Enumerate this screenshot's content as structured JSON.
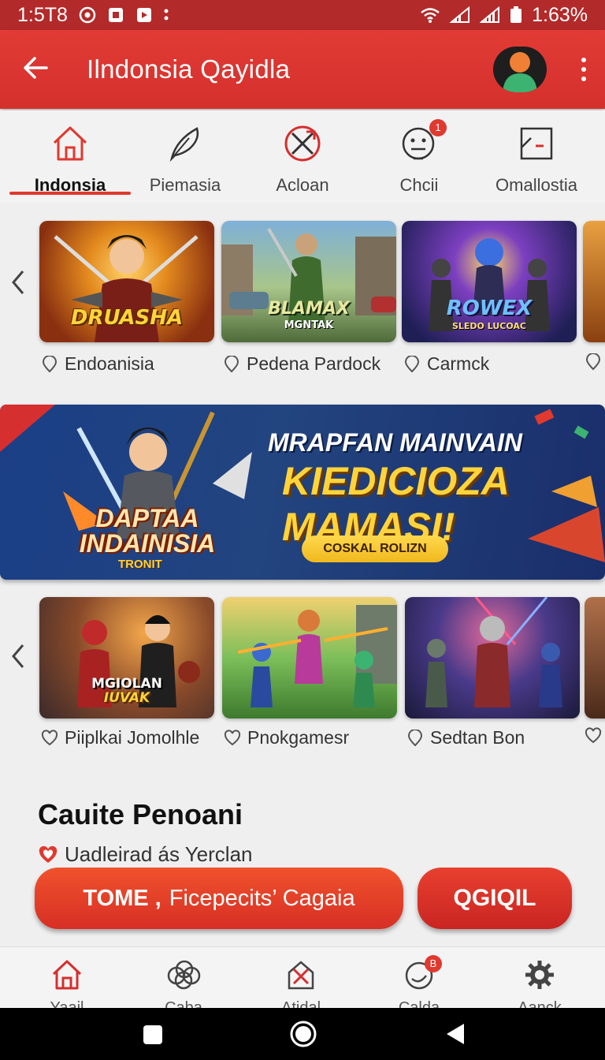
{
  "status_bar": {
    "time": "1:5T8",
    "battery": "1:63%"
  },
  "app_bar": {
    "title": "Ilndonsia Qayidla"
  },
  "category_tabs": [
    {
      "label": "Indonsia",
      "active": true,
      "icon": "home-icon"
    },
    {
      "label": "Piemasia",
      "active": false,
      "icon": "feather-icon"
    },
    {
      "label": "Acloan",
      "active": false,
      "icon": "crossed-swords-icon"
    },
    {
      "label": "Chcii",
      "active": false,
      "icon": "face-icon",
      "badge": "1"
    },
    {
      "label": "Omallostia",
      "active": false,
      "icon": "chart-icon"
    }
  ],
  "row1": [
    {
      "art_title": "DRUASHA",
      "label": "Endoanisia"
    },
    {
      "art_title": "BLAMAX",
      "art_sub": "MGNTAK",
      "label": "Pedena Pardock"
    },
    {
      "art_title": "ROWEX",
      "art_sub": "SLEDO LUCOAC",
      "label": "Carmck"
    }
  ],
  "hero": {
    "game_title": "DAPTAA INDAINISIA",
    "game_sub": "TRONIT",
    "headline1": "MRAPFAN MAINVAIN",
    "headline2": "KIEDICIOZA",
    "headline3": "MAMASI!",
    "button": "COSKAL ROLIZN"
  },
  "row2": [
    {
      "art_title": "MGIOLAN",
      "art_sub": "IUVAK",
      "label": "Piiplkai Jomolhle"
    },
    {
      "label": "Pnokgamesr"
    },
    {
      "label": "Sedtan Bon"
    }
  ],
  "section": {
    "title": "Cauite Penoani",
    "subtitle": "Uadleirad ás Yerclan"
  },
  "cta": {
    "main_bold": "TOME ,",
    "main_text": "Ficepecits’ Cagaia",
    "side": "QGIQIL"
  },
  "bottom_nav": [
    {
      "label": "Yaail",
      "icon": "home-icon"
    },
    {
      "label": "Caba",
      "icon": "cloud-icon"
    },
    {
      "label": "Atidal",
      "icon": "swords-icon"
    },
    {
      "label": "Calda",
      "icon": "chat-icon",
      "badge": "B"
    },
    {
      "label": "Aanck",
      "icon": "gear-icon"
    }
  ],
  "colors": {
    "primary": "#d4302c",
    "accent": "#e0392f",
    "gold": "#ffd43a"
  }
}
